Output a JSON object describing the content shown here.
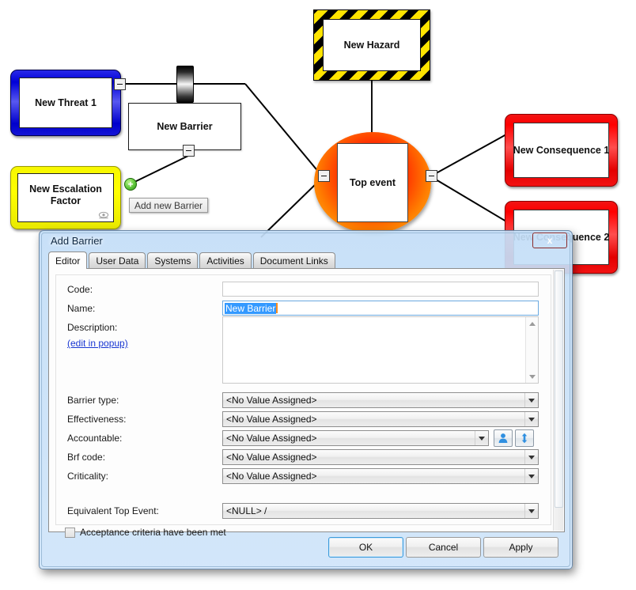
{
  "diagram": {
    "nodes": {
      "threat": "New Threat 1",
      "barrier": "New Barrier",
      "escalation_factor": "New Escalation Factor",
      "hazard": "New Hazard",
      "top_event": "Top event",
      "consequence_1": "New Consequence 1",
      "consequence_2": "New Consequence 2"
    },
    "tooltip": "Add new Barrier",
    "handle_glyph": "−",
    "plus_glyph": "+",
    "colors": {
      "threat": "#0000d8",
      "escalation_factor": "#ffff00",
      "hazard_stripe": "#ffe400",
      "top_event": "#ff2a00",
      "consequence": "#ff0000"
    }
  },
  "dialog": {
    "title": "Add Barrier",
    "close_label": "x",
    "tabs": [
      {
        "label": "Editor",
        "active": true
      },
      {
        "label": "User Data",
        "active": false
      },
      {
        "label": "Systems",
        "active": false
      },
      {
        "label": "Activities",
        "active": false
      },
      {
        "label": "Document Links",
        "active": false
      }
    ],
    "fields": {
      "code": {
        "label": "Code:",
        "value": ""
      },
      "name": {
        "label": "Name:",
        "value": "New Barrier"
      },
      "description": {
        "label": "Description:",
        "link": "(edit in popup)",
        "value": ""
      },
      "barrier_type": {
        "label": "Barrier type:",
        "value": "<No Value Assigned>"
      },
      "effectiveness": {
        "label": "Effectiveness:",
        "value": "<No Value Assigned>"
      },
      "accountable": {
        "label": "Accountable:",
        "value": "<No Value Assigned>"
      },
      "brf_code": {
        "label": "Brf code:",
        "value": "<No Value Assigned>"
      },
      "criticality": {
        "label": "Criticality:",
        "value": "<No Value Assigned>"
      },
      "equivalent_top_event": {
        "label": "Equivalent Top Event:",
        "value": "<NULL> /"
      }
    },
    "checkbox": {
      "label": "Acceptance criteria have been met",
      "checked": false
    },
    "buttons": {
      "ok": "OK",
      "cancel": "Cancel",
      "apply": "Apply"
    }
  }
}
